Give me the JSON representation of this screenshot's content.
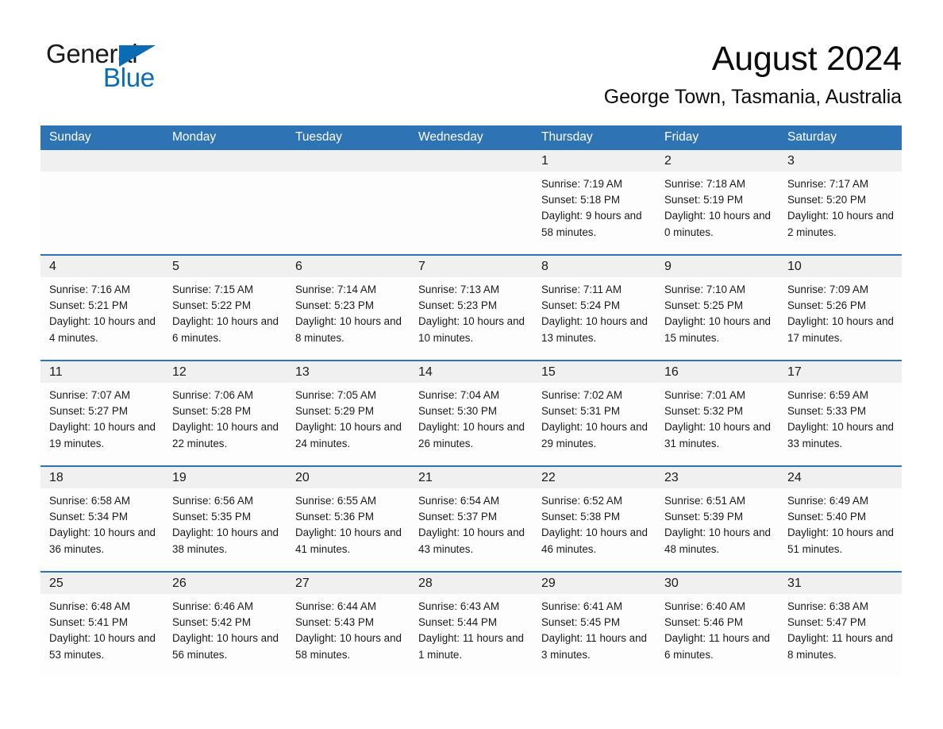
{
  "brand": {
    "name_part1": "General",
    "name_part2": "Blue",
    "triangle_color": "#0b6cb3",
    "text_color": "#1a1a1a"
  },
  "header": {
    "title": "August 2024",
    "subtitle": "George Town, Tasmania, Australia"
  },
  "theme": {
    "header_blue": "#2e74b5",
    "daynum_band": "#f0f0f0",
    "cell_bg": "#fdfdfd",
    "text": "#1a1a1a"
  },
  "weekdays": [
    "Sunday",
    "Monday",
    "Tuesday",
    "Wednesday",
    "Thursday",
    "Friday",
    "Saturday"
  ],
  "weeks": [
    [
      {
        "day": "",
        "lines": []
      },
      {
        "day": "",
        "lines": []
      },
      {
        "day": "",
        "lines": []
      },
      {
        "day": "",
        "lines": []
      },
      {
        "day": "1",
        "lines": [
          "Sunrise: 7:19 AM",
          "Sunset: 5:18 PM",
          "Daylight: 9 hours and 58 minutes."
        ]
      },
      {
        "day": "2",
        "lines": [
          "Sunrise: 7:18 AM",
          "Sunset: 5:19 PM",
          "Daylight: 10 hours and 0 minutes."
        ]
      },
      {
        "day": "3",
        "lines": [
          "Sunrise: 7:17 AM",
          "Sunset: 5:20 PM",
          "Daylight: 10 hours and 2 minutes."
        ]
      }
    ],
    [
      {
        "day": "4",
        "lines": [
          "Sunrise: 7:16 AM",
          "Sunset: 5:21 PM",
          "Daylight: 10 hours and 4 minutes."
        ]
      },
      {
        "day": "5",
        "lines": [
          "Sunrise: 7:15 AM",
          "Sunset: 5:22 PM",
          "Daylight: 10 hours and 6 minutes."
        ]
      },
      {
        "day": "6",
        "lines": [
          "Sunrise: 7:14 AM",
          "Sunset: 5:23 PM",
          "Daylight: 10 hours and 8 minutes."
        ]
      },
      {
        "day": "7",
        "lines": [
          "Sunrise: 7:13 AM",
          "Sunset: 5:23 PM",
          "Daylight: 10 hours and 10 minutes."
        ]
      },
      {
        "day": "8",
        "lines": [
          "Sunrise: 7:11 AM",
          "Sunset: 5:24 PM",
          "Daylight: 10 hours and 13 minutes."
        ]
      },
      {
        "day": "9",
        "lines": [
          "Sunrise: 7:10 AM",
          "Sunset: 5:25 PM",
          "Daylight: 10 hours and 15 minutes."
        ]
      },
      {
        "day": "10",
        "lines": [
          "Sunrise: 7:09 AM",
          "Sunset: 5:26 PM",
          "Daylight: 10 hours and 17 minutes."
        ]
      }
    ],
    [
      {
        "day": "11",
        "lines": [
          "Sunrise: 7:07 AM",
          "Sunset: 5:27 PM",
          "Daylight: 10 hours and 19 minutes."
        ]
      },
      {
        "day": "12",
        "lines": [
          "Sunrise: 7:06 AM",
          "Sunset: 5:28 PM",
          "Daylight: 10 hours and 22 minutes."
        ]
      },
      {
        "day": "13",
        "lines": [
          "Sunrise: 7:05 AM",
          "Sunset: 5:29 PM",
          "Daylight: 10 hours and 24 minutes."
        ]
      },
      {
        "day": "14",
        "lines": [
          "Sunrise: 7:04 AM",
          "Sunset: 5:30 PM",
          "Daylight: 10 hours and 26 minutes."
        ]
      },
      {
        "day": "15",
        "lines": [
          "Sunrise: 7:02 AM",
          "Sunset: 5:31 PM",
          "Daylight: 10 hours and 29 minutes."
        ]
      },
      {
        "day": "16",
        "lines": [
          "Sunrise: 7:01 AM",
          "Sunset: 5:32 PM",
          "Daylight: 10 hours and 31 minutes."
        ]
      },
      {
        "day": "17",
        "lines": [
          "Sunrise: 6:59 AM",
          "Sunset: 5:33 PM",
          "Daylight: 10 hours and 33 minutes."
        ]
      }
    ],
    [
      {
        "day": "18",
        "lines": [
          "Sunrise: 6:58 AM",
          "Sunset: 5:34 PM",
          "Daylight: 10 hours and 36 minutes."
        ]
      },
      {
        "day": "19",
        "lines": [
          "Sunrise: 6:56 AM",
          "Sunset: 5:35 PM",
          "Daylight: 10 hours and 38 minutes."
        ]
      },
      {
        "day": "20",
        "lines": [
          "Sunrise: 6:55 AM",
          "Sunset: 5:36 PM",
          "Daylight: 10 hours and 41 minutes."
        ]
      },
      {
        "day": "21",
        "lines": [
          "Sunrise: 6:54 AM",
          "Sunset: 5:37 PM",
          "Daylight: 10 hours and 43 minutes."
        ]
      },
      {
        "day": "22",
        "lines": [
          "Sunrise: 6:52 AM",
          "Sunset: 5:38 PM",
          "Daylight: 10 hours and 46 minutes."
        ]
      },
      {
        "day": "23",
        "lines": [
          "Sunrise: 6:51 AM",
          "Sunset: 5:39 PM",
          "Daylight: 10 hours and 48 minutes."
        ]
      },
      {
        "day": "24",
        "lines": [
          "Sunrise: 6:49 AM",
          "Sunset: 5:40 PM",
          "Daylight: 10 hours and 51 minutes."
        ]
      }
    ],
    [
      {
        "day": "25",
        "lines": [
          "Sunrise: 6:48 AM",
          "Sunset: 5:41 PM",
          "Daylight: 10 hours and 53 minutes."
        ]
      },
      {
        "day": "26",
        "lines": [
          "Sunrise: 6:46 AM",
          "Sunset: 5:42 PM",
          "Daylight: 10 hours and 56 minutes."
        ]
      },
      {
        "day": "27",
        "lines": [
          "Sunrise: 6:44 AM",
          "Sunset: 5:43 PM",
          "Daylight: 10 hours and 58 minutes."
        ]
      },
      {
        "day": "28",
        "lines": [
          "Sunrise: 6:43 AM",
          "Sunset: 5:44 PM",
          "Daylight: 11 hours and 1 minute."
        ]
      },
      {
        "day": "29",
        "lines": [
          "Sunrise: 6:41 AM",
          "Sunset: 5:45 PM",
          "Daylight: 11 hours and 3 minutes."
        ]
      },
      {
        "day": "30",
        "lines": [
          "Sunrise: 6:40 AM",
          "Sunset: 5:46 PM",
          "Daylight: 11 hours and 6 minutes."
        ]
      },
      {
        "day": "31",
        "lines": [
          "Sunrise: 6:38 AM",
          "Sunset: 5:47 PM",
          "Daylight: 11 hours and 8 minutes."
        ]
      }
    ]
  ]
}
